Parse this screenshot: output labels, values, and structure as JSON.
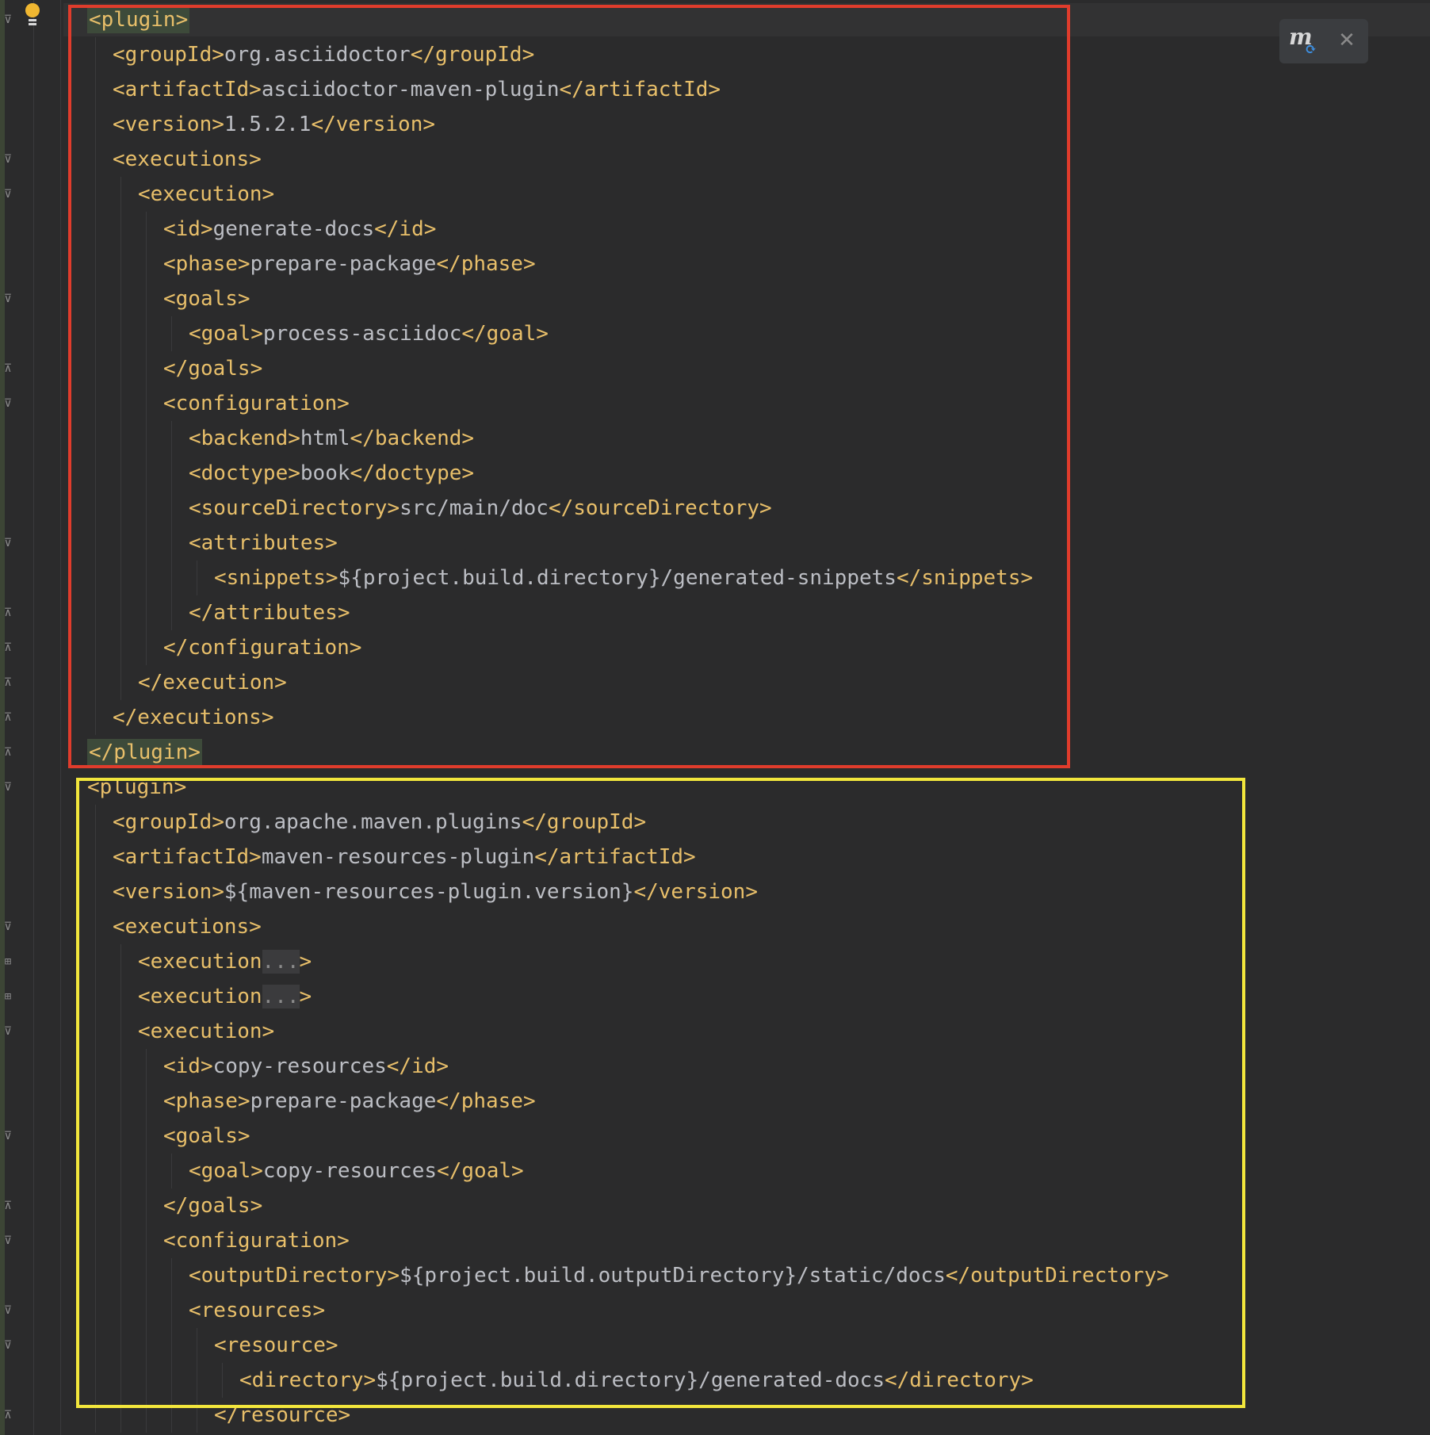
{
  "editor": {
    "language": "xml",
    "theme": "dark",
    "highlighted_tag": "plugin",
    "lines": [
      {
        "indent": 0,
        "parts": [
          {
            "t": "tag",
            "v": "<plugin>",
            "hl": true
          }
        ]
      },
      {
        "indent": 1,
        "parts": [
          {
            "t": "tag",
            "v": "<groupId>"
          },
          {
            "t": "txt",
            "v": "org.asciidoctor"
          },
          {
            "t": "tag",
            "v": "</groupId>"
          }
        ]
      },
      {
        "indent": 1,
        "parts": [
          {
            "t": "tag",
            "v": "<artifactId>"
          },
          {
            "t": "txt",
            "v": "asciidoctor-maven-plugin"
          },
          {
            "t": "tag",
            "v": "</artifactId>"
          }
        ]
      },
      {
        "indent": 1,
        "parts": [
          {
            "t": "tag",
            "v": "<version>"
          },
          {
            "t": "txt",
            "v": "1.5.2.1"
          },
          {
            "t": "tag",
            "v": "</version>"
          }
        ]
      },
      {
        "indent": 1,
        "parts": [
          {
            "t": "tag",
            "v": "<executions>"
          }
        ]
      },
      {
        "indent": 2,
        "parts": [
          {
            "t": "tag",
            "v": "<execution>"
          }
        ]
      },
      {
        "indent": 3,
        "parts": [
          {
            "t": "tag",
            "v": "<id>"
          },
          {
            "t": "txt",
            "v": "generate-docs"
          },
          {
            "t": "tag",
            "v": "</id>"
          }
        ]
      },
      {
        "indent": 3,
        "parts": [
          {
            "t": "tag",
            "v": "<phase>"
          },
          {
            "t": "txt",
            "v": "prepare-package"
          },
          {
            "t": "tag",
            "v": "</phase>"
          }
        ]
      },
      {
        "indent": 3,
        "parts": [
          {
            "t": "tag",
            "v": "<goals>"
          }
        ]
      },
      {
        "indent": 4,
        "parts": [
          {
            "t": "tag",
            "v": "<goal>"
          },
          {
            "t": "txt",
            "v": "process-asciidoc"
          },
          {
            "t": "tag",
            "v": "</goal>"
          }
        ]
      },
      {
        "indent": 3,
        "parts": [
          {
            "t": "tag",
            "v": "</goals>"
          }
        ]
      },
      {
        "indent": 3,
        "parts": [
          {
            "t": "tag",
            "v": "<configuration>"
          }
        ]
      },
      {
        "indent": 4,
        "parts": [
          {
            "t": "tag",
            "v": "<backend>"
          },
          {
            "t": "txt",
            "v": "html"
          },
          {
            "t": "tag",
            "v": "</backend>"
          }
        ]
      },
      {
        "indent": 4,
        "parts": [
          {
            "t": "tag",
            "v": "<doctype>"
          },
          {
            "t": "txt",
            "v": "book"
          },
          {
            "t": "tag",
            "v": "</doctype>"
          }
        ]
      },
      {
        "indent": 4,
        "parts": [
          {
            "t": "tag",
            "v": "<sourceDirectory>"
          },
          {
            "t": "txt",
            "v": "src/main/doc"
          },
          {
            "t": "tag",
            "v": "</sourceDirectory>"
          }
        ]
      },
      {
        "indent": 4,
        "parts": [
          {
            "t": "tag",
            "v": "<attributes>"
          }
        ]
      },
      {
        "indent": 5,
        "parts": [
          {
            "t": "tag",
            "v": "<snippets>"
          },
          {
            "t": "txt",
            "v": "${project.build.directory}/generated-snippets"
          },
          {
            "t": "tag",
            "v": "</snippets>"
          }
        ]
      },
      {
        "indent": 4,
        "parts": [
          {
            "t": "tag",
            "v": "</attributes>"
          }
        ]
      },
      {
        "indent": 3,
        "parts": [
          {
            "t": "tag",
            "v": "</configuration>"
          }
        ]
      },
      {
        "indent": 2,
        "parts": [
          {
            "t": "tag",
            "v": "</execution>"
          }
        ]
      },
      {
        "indent": 1,
        "parts": [
          {
            "t": "tag",
            "v": "</executions>"
          }
        ]
      },
      {
        "indent": 0,
        "parts": [
          {
            "t": "tag",
            "v": "</plugin>",
            "hl": true
          }
        ]
      },
      {
        "indent": 0,
        "parts": [
          {
            "t": "tag",
            "v": "<plugin>"
          }
        ]
      },
      {
        "indent": 1,
        "parts": [
          {
            "t": "tag",
            "v": "<groupId>"
          },
          {
            "t": "txt",
            "v": "org.apache.maven.plugins"
          },
          {
            "t": "tag",
            "v": "</groupId>"
          }
        ]
      },
      {
        "indent": 1,
        "parts": [
          {
            "t": "tag",
            "v": "<artifactId>"
          },
          {
            "t": "txt",
            "v": "maven-resources-plugin"
          },
          {
            "t": "tag",
            "v": "</artifactId>"
          }
        ]
      },
      {
        "indent": 1,
        "parts": [
          {
            "t": "tag",
            "v": "<version>"
          },
          {
            "t": "txt",
            "v": "${maven-resources-plugin.version}"
          },
          {
            "t": "tag",
            "v": "</version>"
          }
        ]
      },
      {
        "indent": 1,
        "parts": [
          {
            "t": "tag",
            "v": "<executions>"
          }
        ]
      },
      {
        "indent": 2,
        "parts": [
          {
            "t": "tag",
            "v": "<execution"
          },
          {
            "t": "fold",
            "v": "..."
          },
          {
            "t": "tag",
            "v": ">"
          }
        ]
      },
      {
        "indent": 2,
        "parts": [
          {
            "t": "tag",
            "v": "<execution"
          },
          {
            "t": "fold",
            "v": "..."
          },
          {
            "t": "tag",
            "v": ">"
          }
        ]
      },
      {
        "indent": 2,
        "parts": [
          {
            "t": "tag",
            "v": "<execution>"
          }
        ]
      },
      {
        "indent": 3,
        "parts": [
          {
            "t": "tag",
            "v": "<id>"
          },
          {
            "t": "txt",
            "v": "copy-resources"
          },
          {
            "t": "tag",
            "v": "</id>"
          }
        ]
      },
      {
        "indent": 3,
        "parts": [
          {
            "t": "tag",
            "v": "<phase>"
          },
          {
            "t": "txt",
            "v": "prepare-package"
          },
          {
            "t": "tag",
            "v": "</phase>"
          }
        ]
      },
      {
        "indent": 3,
        "parts": [
          {
            "t": "tag",
            "v": "<goals>"
          }
        ]
      },
      {
        "indent": 4,
        "parts": [
          {
            "t": "tag",
            "v": "<goal>"
          },
          {
            "t": "txt",
            "v": "copy-resources"
          },
          {
            "t": "tag",
            "v": "</goal>"
          }
        ]
      },
      {
        "indent": 3,
        "parts": [
          {
            "t": "tag",
            "v": "</goals>"
          }
        ]
      },
      {
        "indent": 3,
        "parts": [
          {
            "t": "tag",
            "v": "<configuration>"
          }
        ]
      },
      {
        "indent": 4,
        "parts": [
          {
            "t": "tag",
            "v": "<outputDirectory>"
          },
          {
            "t": "txt",
            "v": "${project.build.outputDirectory}/static/docs"
          },
          {
            "t": "tag",
            "v": "</outputDirectory>"
          }
        ]
      },
      {
        "indent": 4,
        "parts": [
          {
            "t": "tag",
            "v": "<resources>"
          }
        ]
      },
      {
        "indent": 5,
        "parts": [
          {
            "t": "tag",
            "v": "<resource>"
          }
        ]
      },
      {
        "indent": 6,
        "parts": [
          {
            "t": "tag",
            "v": "<directory>"
          },
          {
            "t": "txt",
            "v": "${project.build.directory}/generated-docs"
          },
          {
            "t": "tag",
            "v": "</directory>"
          }
        ]
      },
      {
        "indent": 5,
        "parts": [
          {
            "t": "tag",
            "v": "</resource>"
          }
        ]
      }
    ]
  },
  "gutter": {
    "fold_markers": [
      {
        "line": 0,
        "type": "open"
      },
      {
        "line": 4,
        "type": "open"
      },
      {
        "line": 5,
        "type": "open"
      },
      {
        "line": 8,
        "type": "open"
      },
      {
        "line": 10,
        "type": "close"
      },
      {
        "line": 11,
        "type": "open"
      },
      {
        "line": 15,
        "type": "open"
      },
      {
        "line": 17,
        "type": "close"
      },
      {
        "line": 18,
        "type": "close"
      },
      {
        "line": 19,
        "type": "close"
      },
      {
        "line": 20,
        "type": "close"
      },
      {
        "line": 21,
        "type": "close"
      },
      {
        "line": 22,
        "type": "open"
      },
      {
        "line": 26,
        "type": "open"
      },
      {
        "line": 27,
        "type": "expand"
      },
      {
        "line": 28,
        "type": "expand"
      },
      {
        "line": 29,
        "type": "open"
      },
      {
        "line": 32,
        "type": "open"
      },
      {
        "line": 34,
        "type": "close"
      },
      {
        "line": 35,
        "type": "open"
      },
      {
        "line": 37,
        "type": "open"
      },
      {
        "line": 38,
        "type": "open"
      },
      {
        "line": 40,
        "type": "close"
      }
    ],
    "intention_icon": "lightbulb-icon"
  },
  "popup": {
    "icon": "maven-reload-icon",
    "close_icon": "close-icon"
  },
  "annotations": {
    "red_box_color": "#e03c2c",
    "yellow_box_color": "#f2e63c"
  },
  "colors": {
    "background": "#2b2b2c",
    "tag": "#e8bf6a",
    "text": "#bcbec4"
  }
}
